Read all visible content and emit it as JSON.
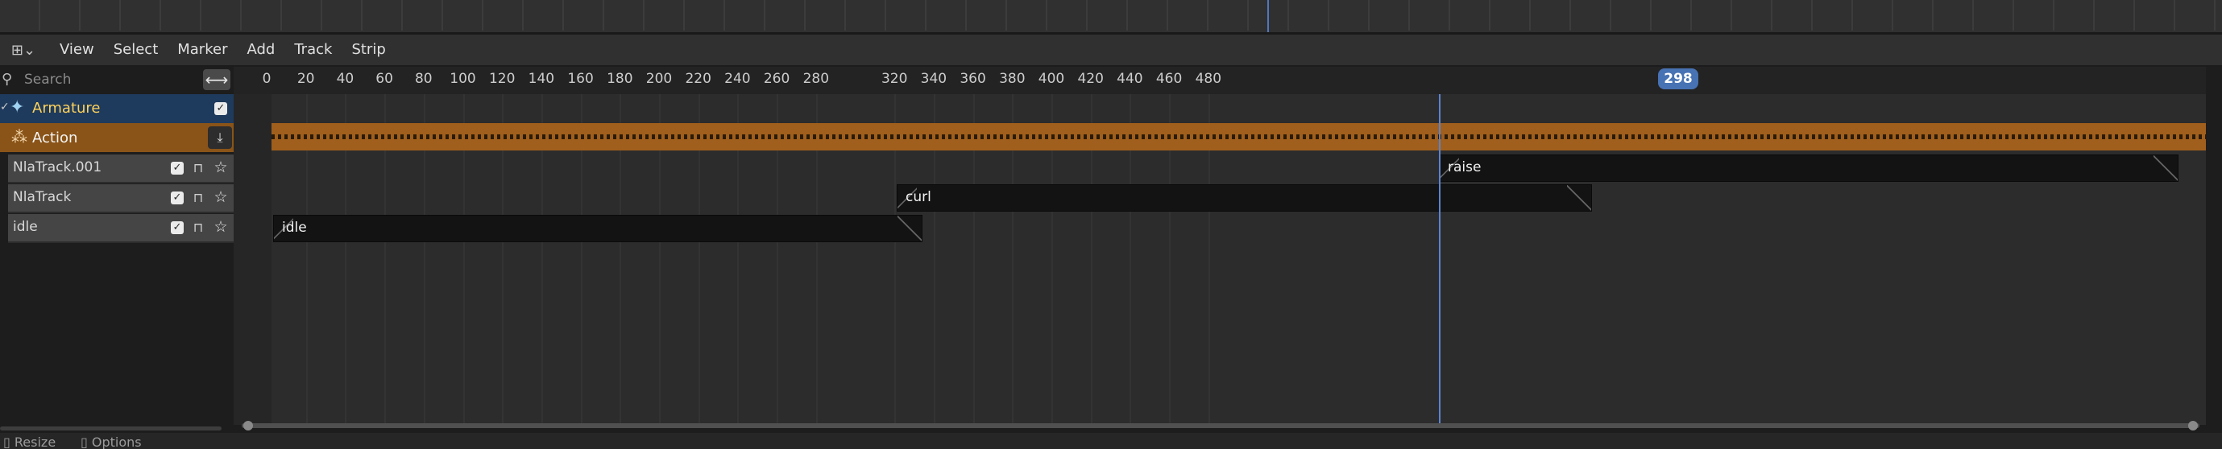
{
  "header": {
    "editor_type_icon": "nla-editor-icon",
    "menus": [
      "View",
      "Select",
      "Marker",
      "Add",
      "Track",
      "Strip"
    ]
  },
  "channels": {
    "search": {
      "placeholder": "Search",
      "value": ""
    },
    "object": {
      "label": "Armature",
      "enabled": true
    },
    "action": {
      "label": "Action"
    },
    "tracks": [
      {
        "label": "NlaTrack.001",
        "enabled": true
      },
      {
        "label": "NlaTrack",
        "enabled": true
      },
      {
        "label": "idle",
        "enabled": true
      }
    ]
  },
  "ruler": {
    "labels": [
      "0",
      "20",
      "40",
      "60",
      "80",
      "100",
      "120",
      "140",
      "160",
      "180",
      "200",
      "220",
      "240",
      "260",
      "280",
      "320",
      "340",
      "360",
      "380",
      "400",
      "420",
      "440",
      "460",
      "480"
    ],
    "current_frame": "298"
  },
  "strips": [
    {
      "label": "raise",
      "track": "NlaTrack.001"
    },
    {
      "label": "curl",
      "track": "NlaTrack"
    },
    {
      "label": "idle",
      "track": "idle"
    }
  ],
  "status_bar": {
    "items": [
      "Resize",
      "Options"
    ]
  },
  "colors": {
    "accent": "#4772b3",
    "object_label": "#ffd25a",
    "action_row": "#8a5418",
    "selected_channel": "#1e3a5c"
  }
}
